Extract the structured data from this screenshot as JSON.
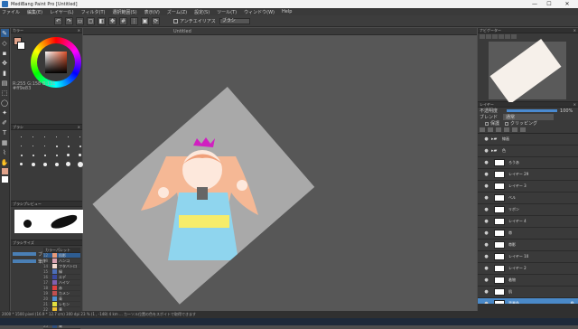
{
  "title": "MediBang Paint Pro [Untitled]",
  "menu": [
    "ファイル",
    "編集(E)",
    "レイヤー(L)",
    "フィルタ(T)",
    "選択範囲(S)",
    "表示(V)",
    "ズーム(Z)",
    "設定(S)",
    "ツール(T)",
    "ウィンドウ(W)",
    "Help"
  ],
  "toolbar": {
    "antialias_label": "アンチエイリアス",
    "mode_value": "ブラシ"
  },
  "panels": {
    "color": "カラー",
    "brush": "ブラシ",
    "brush_preview": "ブラシプレビュー",
    "brush_size": "ブラシサイズ",
    "palette": "カラーパレット",
    "navigator": "ナビゲーター",
    "layer": "レイヤー"
  },
  "color_info": {
    "rgb": "R:255 G:158 B:131",
    "hex": "#ff9e83"
  },
  "brush_params": [
    {
      "label": "ブラシ"
    },
    {
      "label": "筆圧"
    }
  ],
  "palette": [
    {
      "n": "12",
      "name": "肌影",
      "color": "#e89a7a"
    },
    {
      "n": "13",
      "name": "ハンコ",
      "color": "#d8a0b0"
    },
    {
      "n": "14",
      "name": "フタバトロ",
      "color": "#f3d9cf"
    },
    {
      "n": "15",
      "name": "緑",
      "color": "#4c6fb8"
    },
    {
      "n": "16",
      "name": "エデ",
      "color": "#3a4aa0"
    },
    {
      "n": "17",
      "name": "ハイツ",
      "color": "#8060b0"
    },
    {
      "n": "18",
      "name": "赤",
      "color": "#e04040"
    },
    {
      "n": "19",
      "name": "カメン",
      "color": "#c05050"
    },
    {
      "n": "20",
      "name": "青",
      "color": "#5090d0"
    },
    {
      "n": "21",
      "name": "レモン",
      "color": "#e0e040"
    },
    {
      "n": "22",
      "name": "黄",
      "color": "#f0c030"
    },
    {
      "n": "23",
      "name": "ムラサキ",
      "color": "#8040a0"
    },
    {
      "n": "24",
      "name": "緑",
      "color": "#40a040"
    },
    {
      "n": "25",
      "name": "青",
      "color": "#305080"
    }
  ],
  "canvas": {
    "tab": "Untitled"
  },
  "layer_panel": {
    "opacity_label": "不透明度",
    "opacity_value": "100%",
    "blend_label": "ブレンド",
    "blend_value": "通常",
    "protect_label": "保護",
    "clip_label": "クリッピング"
  },
  "layers": [
    {
      "name": "線画",
      "folder": true
    },
    {
      "name": "色",
      "folder": true
    },
    {
      "name": "ろうあ",
      "folder": false
    },
    {
      "name": "レイヤー 29",
      "folder": false
    },
    {
      "name": "レイヤー 3",
      "folder": false
    },
    {
      "name": "ベル",
      "folder": false
    },
    {
      "name": "リボン",
      "folder": false
    },
    {
      "name": "レイヤー 4",
      "folder": false
    },
    {
      "name": "帯",
      "folder": false
    },
    {
      "name": "帯影",
      "folder": false
    },
    {
      "name": "レイヤー 10",
      "folder": false
    },
    {
      "name": "レイヤー 2",
      "folder": false
    },
    {
      "name": "着物",
      "folder": false
    },
    {
      "name": "肌",
      "folder": false
    },
    {
      "name": "背景色",
      "folder": false,
      "selected": true
    }
  ],
  "status": "2000 * 1500 pixel (16.9 * 12.7 cm) 300 dpi 23 % (1 , -148) 4 km ... カーソル位置の色をスポイトで取得できます"
}
